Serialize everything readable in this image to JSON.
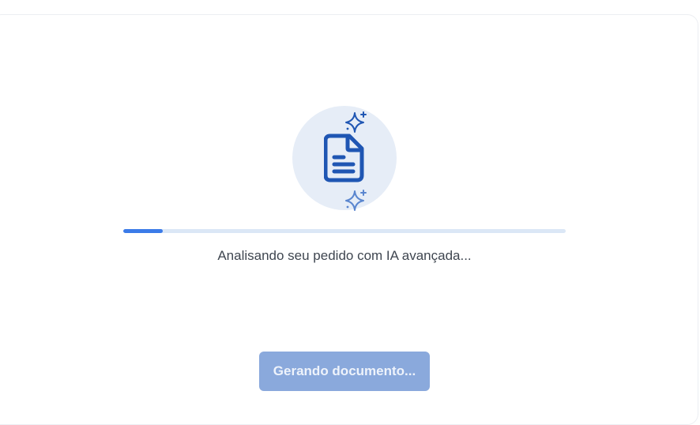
{
  "loader": {
    "icon": "document-icon",
    "sparkle_icon": "sparkle-icon",
    "accent_color": "#1f56b3",
    "progress_fraction": 0.09,
    "status_text": "Analisando seu pedido com IA avançada..."
  },
  "action": {
    "button_label": "Gerando documento..."
  }
}
